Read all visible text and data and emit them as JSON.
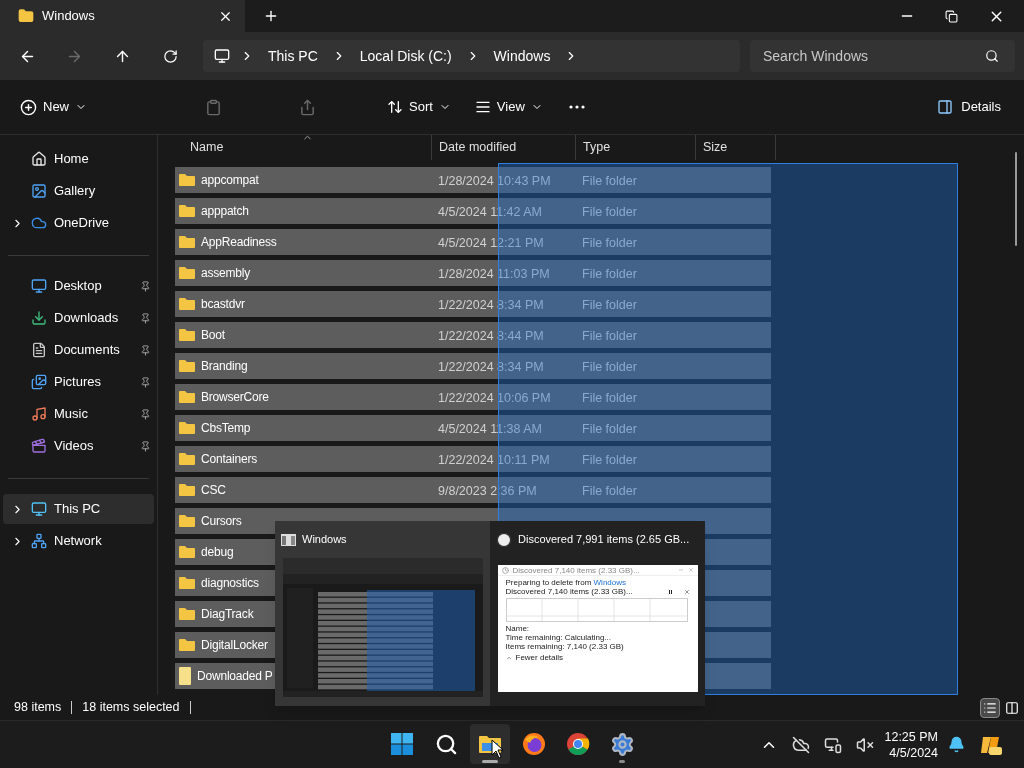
{
  "window": {
    "tab_title": "Windows"
  },
  "nav": {
    "back": {
      "disabled": false
    },
    "forward": {
      "disabled": true
    },
    "up": {
      "disabled": false
    }
  },
  "address": {
    "segments": [
      "This PC",
      "Local Disk (C:)",
      "Windows"
    ]
  },
  "search": {
    "placeholder": "Search Windows"
  },
  "toolbar": {
    "items": [
      {
        "kind": "new",
        "label": "New",
        "disabled": false
      },
      {
        "kind": "paste",
        "disabled": true
      },
      {
        "kind": "share",
        "disabled": true
      },
      {
        "kind": "sort",
        "label": "Sort",
        "disabled": false
      },
      {
        "kind": "view",
        "label": "View",
        "disabled": false
      },
      {
        "kind": "more",
        "disabled": false
      }
    ],
    "details": {
      "label": "Details"
    }
  },
  "sidebar": {
    "groups": [
      [
        {
          "label": "Home",
          "kind": "home",
          "expandable": false,
          "pinned": false,
          "selected": false
        },
        {
          "label": "Gallery",
          "kind": "gallery",
          "expandable": false,
          "pinned": false,
          "selected": false
        },
        {
          "label": "OneDrive",
          "kind": "cloud",
          "expandable": true,
          "pinned": false,
          "selected": false
        }
      ],
      [
        {
          "label": "Desktop",
          "kind": "desktop",
          "expandable": false,
          "pinned": true,
          "selected": false
        },
        {
          "label": "Downloads",
          "kind": "download",
          "expandable": false,
          "pinned": true,
          "selected": false
        },
        {
          "label": "Documents",
          "kind": "document",
          "expandable": false,
          "pinned": true,
          "selected": false
        },
        {
          "label": "Pictures",
          "kind": "pictures",
          "expandable": false,
          "pinned": true,
          "selected": false
        },
        {
          "label": "Music",
          "kind": "music",
          "expandable": false,
          "pinned": true,
          "selected": false
        },
        {
          "label": "Videos",
          "kind": "video",
          "expandable": false,
          "pinned": true,
          "selected": false
        }
      ],
      [
        {
          "label": "This PC",
          "kind": "pc",
          "expandable": true,
          "pinned": false,
          "selected": true
        },
        {
          "label": "Network",
          "kind": "network",
          "expandable": true,
          "pinned": false,
          "selected": false
        }
      ]
    ]
  },
  "table": {
    "columns": [
      {
        "label": "Name",
        "sorted": true
      },
      {
        "label": "Date modified",
        "sorted": false
      },
      {
        "label": "Type",
        "sorted": false
      },
      {
        "label": "Size",
        "sorted": false
      }
    ],
    "rows": [
      {
        "name": "appcompat",
        "date": "1/28/2024 10:43 PM",
        "type": "File folder",
        "kind": "folder",
        "selected": true
      },
      {
        "name": "apppatch",
        "date": "4/5/2024 11:42 AM",
        "type": "File folder",
        "kind": "folder",
        "selected": true
      },
      {
        "name": "AppReadiness",
        "date": "4/5/2024 12:21 PM",
        "type": "File folder",
        "kind": "folder",
        "selected": true
      },
      {
        "name": "assembly",
        "date": "1/28/2024 11:03 PM",
        "type": "File folder",
        "kind": "folder",
        "selected": true
      },
      {
        "name": "bcastdvr",
        "date": "1/22/2024 8:34 PM",
        "type": "File folder",
        "kind": "folder",
        "selected": true
      },
      {
        "name": "Boot",
        "date": "1/22/2024 8:44 PM",
        "type": "File folder",
        "kind": "folder",
        "selected": true
      },
      {
        "name": "Branding",
        "date": "1/22/2024 8:34 PM",
        "type": "File folder",
        "kind": "folder",
        "selected": true
      },
      {
        "name": "BrowserCore",
        "date": "1/22/2024 10:06 PM",
        "type": "File folder",
        "kind": "folder",
        "selected": true
      },
      {
        "name": "CbsTemp",
        "date": "4/5/2024 11:38 AM",
        "type": "File folder",
        "kind": "folder",
        "selected": true
      },
      {
        "name": "Containers",
        "date": "1/22/2024 10:11 PM",
        "type": "File folder",
        "kind": "folder",
        "selected": true
      },
      {
        "name": "CSC",
        "date": "9/8/2023 2:36 PM",
        "type": "File folder",
        "kind": "folder",
        "selected": true
      },
      {
        "name": "Cursors",
        "kind": "folder",
        "selected": true
      },
      {
        "name": "debug",
        "kind": "folder",
        "selected": true
      },
      {
        "name": "diagnostics",
        "kind": "folder",
        "selected": true
      },
      {
        "name": "DiagTrack",
        "kind": "folder",
        "selected": true
      },
      {
        "name": "DigitalLocker",
        "kind": "folder",
        "selected": true
      },
      {
        "name": "Downloaded P",
        "kind": "file",
        "selected": true
      }
    ]
  },
  "status_bar": {
    "items": "98 items",
    "selected": "18 items selected",
    "views": [
      {
        "kind": "details",
        "selected": true
      },
      {
        "kind": "tiles",
        "selected": false
      }
    ]
  },
  "preview": {
    "windows": [
      {
        "kind": "explorer",
        "title": "Windows",
        "hovered": true
      },
      {
        "kind": "progress",
        "title": "Discovered 7,991 items (2.65 GB...",
        "hovered": false,
        "dialog": {
          "title": "Discovered 7,140 items (2.33 GB)...",
          "line1": "Preparing to delete from ",
          "link": "Windows",
          "status": "Discovered 7,140 items (2.33 GB)...",
          "name_label": "Name:",
          "time": "Time remaining: Calculating...",
          "remaining": "Items remaining: 7,140 (2.33 GB)",
          "toggle": "Fewer details"
        }
      }
    ]
  },
  "taskbar": {
    "apps": [
      {
        "kind": "start",
        "open": false,
        "active": false
      },
      {
        "kind": "search",
        "open": false,
        "active": false
      },
      {
        "kind": "explorer",
        "open": true,
        "active": true
      },
      {
        "kind": "firefox",
        "open": false,
        "active": false
      },
      {
        "kind": "chrome",
        "open": false,
        "active": false
      },
      {
        "kind": "settings",
        "open": true,
        "active": false
      }
    ],
    "tray": [
      {
        "kind": "chevron"
      },
      {
        "kind": "cloud_off"
      },
      {
        "kind": "network"
      },
      {
        "kind": "volume_muted"
      }
    ],
    "time": "12:25 PM",
    "date": "4/5/2024"
  }
}
